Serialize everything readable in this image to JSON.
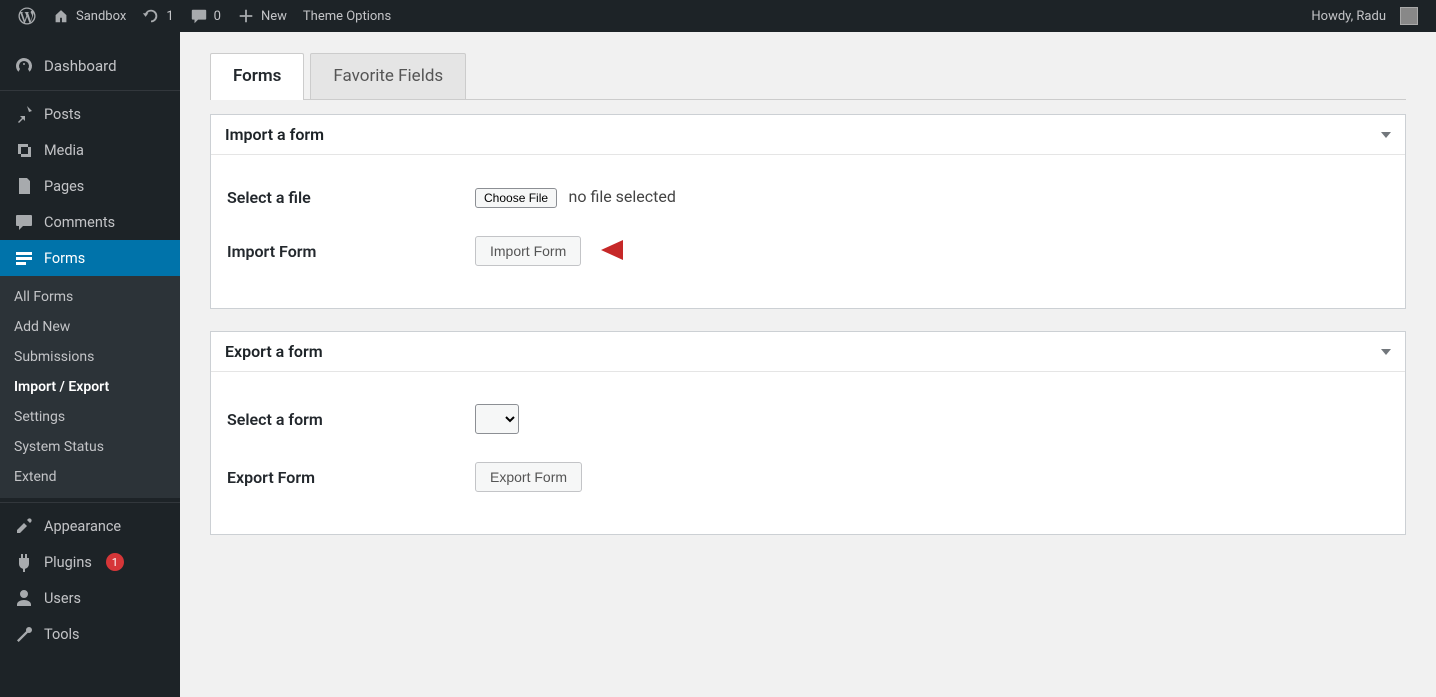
{
  "adminbar": {
    "site_name": "Sandbox",
    "updates": "1",
    "comments": "0",
    "new": "New",
    "theme_options": "Theme Options",
    "howdy": "Howdy, Radu"
  },
  "sidebar": {
    "dashboard": "Dashboard",
    "posts": "Posts",
    "media": "Media",
    "pages": "Pages",
    "comments": "Comments",
    "forms": "Forms",
    "forms_sub": {
      "all": "All Forms",
      "add": "Add New",
      "submissions": "Submissions",
      "import_export": "Import / Export",
      "settings": "Settings",
      "status": "System Status",
      "extend": "Extend"
    },
    "appearance": "Appearance",
    "plugins": "Plugins",
    "plugins_badge": "1",
    "users": "Users",
    "tools": "Tools"
  },
  "tabs": {
    "forms": "Forms",
    "favorite": "Favorite Fields"
  },
  "import_box": {
    "title": "Import a form",
    "select_file_label": "Select a file",
    "choose_file_btn": "Choose File",
    "file_status": "no file selected",
    "import_label": "Import Form",
    "import_btn": "Import Form"
  },
  "export_box": {
    "title": "Export a form",
    "select_form_label": "Select a form",
    "export_label": "Export Form",
    "export_btn": "Export Form"
  }
}
